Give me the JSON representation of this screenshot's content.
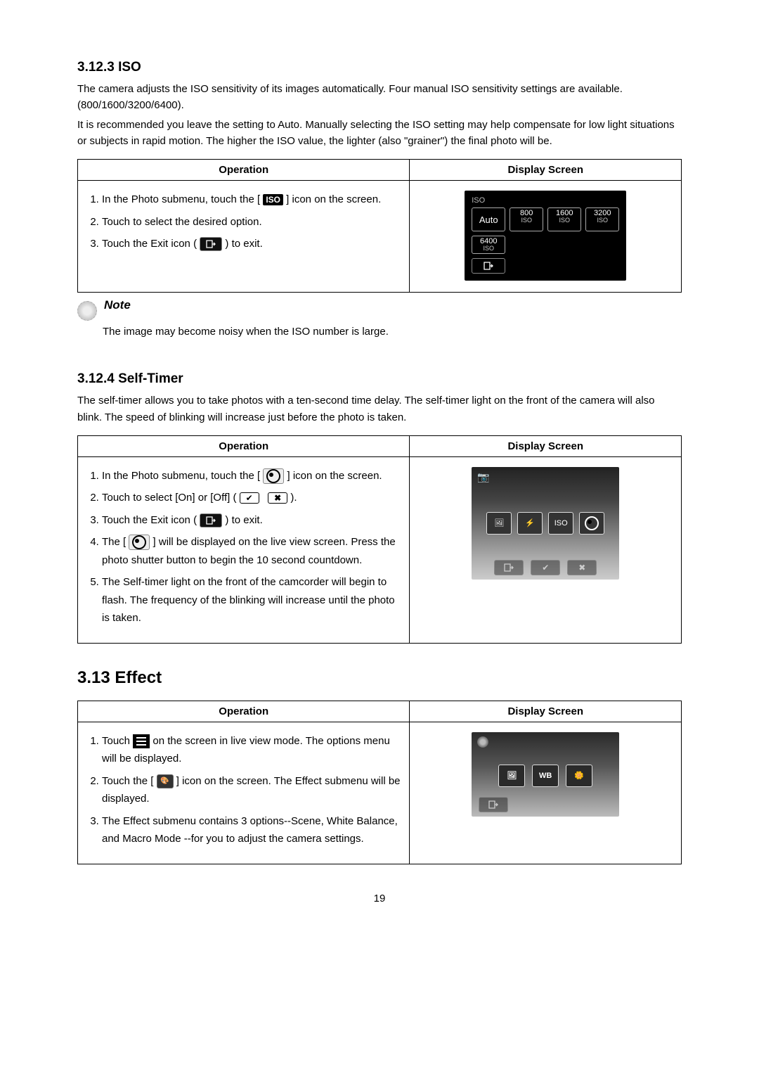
{
  "section_iso": {
    "heading": "3.12.3  ISO",
    "para1": "The camera adjusts the ISO sensitivity of its images automatically. Four manual ISO sensitivity settings are available. (800/1600/3200/6400).",
    "para2": "It is recommended you leave the setting to Auto.  Manually selecting the ISO setting may help compensate for low light situations or subjects in rapid motion.  The higher the ISO value, the lighter (also \"grainer\") the final photo will be.",
    "table_headers": {
      "op": "Operation",
      "disp": "Display Screen"
    },
    "steps": {
      "s1a": "In the Photo submenu, touch the [ ",
      "s1b": " ] icon on the screen.",
      "s2": "Touch to select the desired option.",
      "s3a": "Touch the Exit icon ( ",
      "s3b": " ) to exit."
    },
    "screen": {
      "iso_label": "ISO",
      "auto": "Auto",
      "v800": "800",
      "v1600": "1600",
      "v3200": "3200",
      "v6400": "6400",
      "iso_sub": "ISO"
    },
    "note_title": "Note",
    "note_text": "The image may become noisy when the ISO number is large."
  },
  "section_timer": {
    "heading": "3.12.4  Self-Timer",
    "para": "The self-timer allows you to take photos with a ten-second time delay. The self-timer light on the front of the camera will also blink. The speed of blinking will increase just before the photo is taken.",
    "table_headers": {
      "op": "Operation",
      "disp": "Display Screen"
    },
    "steps": {
      "s1a": "In the Photo submenu, touch the [ ",
      "s1b": " ] icon on the screen.",
      "s2a": "Touch to select [On] or [Off] ( ",
      "s2b": " ).",
      "s3a": "Touch the Exit icon ( ",
      "s3b": " ) to exit.",
      "s4a": "The [ ",
      "s4b": " ] will be displayed on the live view screen.  Press the photo shutter button to begin the 10 second countdown.",
      "s5": "The Self-timer light on the front of the camcorder will begin to flash.  The frequency of the blinking will increase until the photo is taken."
    },
    "screen": {
      "iso_btn": "ISO"
    }
  },
  "section_effect": {
    "heading": "3.13 Effect",
    "table_headers": {
      "op": "Operation",
      "disp": "Display Screen"
    },
    "steps": {
      "s1a": "Touch   ",
      "s1b": "   on the screen in live view mode. The options menu will be displayed.",
      "s2a": "Touch the [ ",
      "s2b": " ] icon on the screen. The Effect submenu will be displayed.",
      "s3": "The Effect submenu contains 3 options--Scene, White Balance, and Macro Mode --for you to adjust the camera settings."
    },
    "screen": {
      "wb": "WB"
    }
  },
  "page_number": "19"
}
